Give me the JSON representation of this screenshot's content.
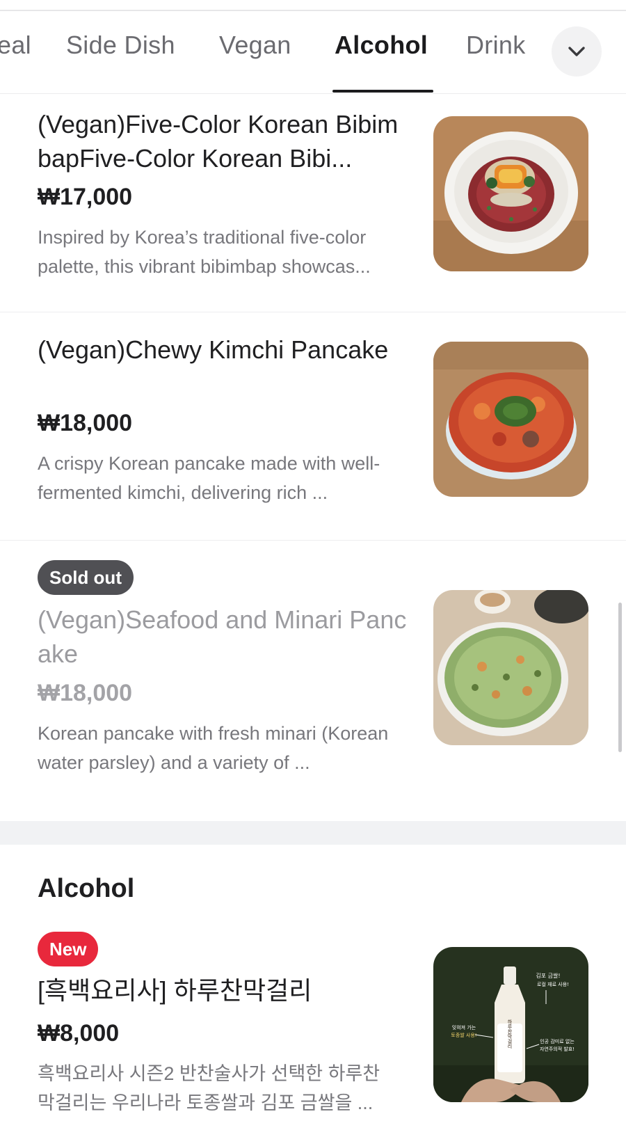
{
  "tabs": [
    {
      "label": "eal",
      "active": false
    },
    {
      "label": "Side Dish",
      "active": false
    },
    {
      "label": "Vegan",
      "active": false
    },
    {
      "label": "Alcohol",
      "active": true
    },
    {
      "label": "Drink",
      "active": false
    }
  ],
  "tab_expand_icon": "chevron-down-icon",
  "items": [
    {
      "name": "(Vegan)Five-Color Korean BibimbapFive-Color Korean Bibi...",
      "price": "₩17,000",
      "description": "Inspired by Korea’s traditional five-color palette, this vibrant bibimbap showcas...",
      "sold_out": false
    },
    {
      "name": "(Vegan)Chewy Kimchi Pancake",
      "price": "₩18,000",
      "description": "A crispy Korean pancake made with well-fermented kimchi, delivering rich ...",
      "sold_out": false
    },
    {
      "badge": "Sold out",
      "name": "(Vegan)Seafood and Minari Pancake",
      "price": "₩18,000",
      "description": "Korean pancake with fresh minari (Korean water parsley) and a variety of ...",
      "sold_out": true
    }
  ],
  "section": {
    "title": "Alcohol",
    "items": [
      {
        "badge": "New",
        "name": "[흑백요리사] 하루찬막걸리",
        "price": "₩8,000",
        "description": "흑백요리사 시즌2 반찬술사가 선택한 하루찬 막걸리는 우리나라 토종쌀과 김포 금쌀을 ...",
        "image_text": {
          "top_right": "김포 금쌀!",
          "top_right_2": "로컬 재료 사용!",
          "left": "잊혀져 가는",
          "left_2": "토종쌀 사용!",
          "bottle": "하루찬막걸리",
          "right": "인공 감미료 없는",
          "right_2": "자연주의적 발효!"
        }
      }
    ]
  },
  "colors": {
    "accent_new": "#e8283c",
    "soldout_badge": "#505054",
    "active_tab": "#1b1b1d",
    "inactive_tab": "#6b6b70"
  }
}
